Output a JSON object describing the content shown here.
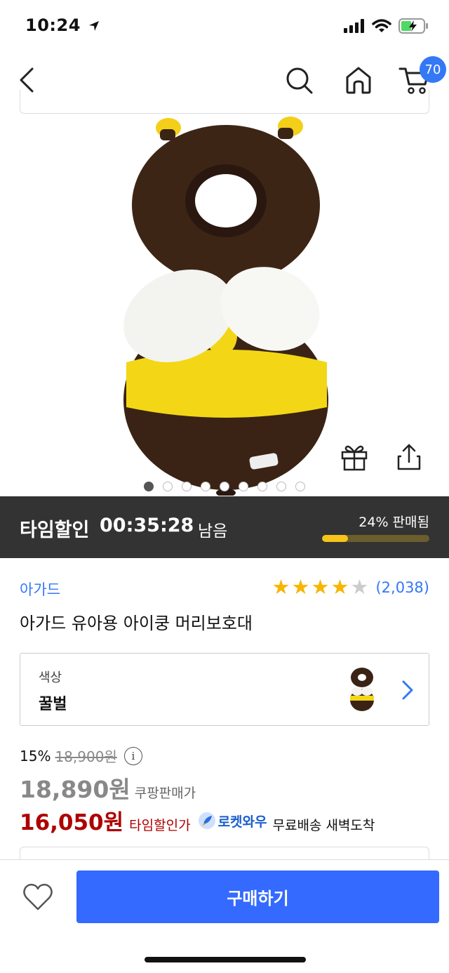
{
  "status": {
    "time": "10:24"
  },
  "nav": {
    "cart_count": "70"
  },
  "carousel": {
    "total": 9,
    "active_index": 4
  },
  "time_sale": {
    "label": "타임할인",
    "countdown": "00:35:28",
    "remaining_label": "남음",
    "sold_label": "24% 판매됨",
    "sold_fraction": 0.24
  },
  "product": {
    "brand": "아가드",
    "title": "아가드 유아용 아이쿵 머리보호대",
    "rating": 4,
    "rating_count": "(2,038)"
  },
  "option": {
    "label": "색상",
    "value": "꿀벌"
  },
  "price": {
    "discount": "15%",
    "original": "18,900원",
    "coupang_price": "18,890원",
    "coupang_label": "쿠팡판매가",
    "sale_price": "16,050원",
    "sale_label": "타임할인가",
    "rocket_label": "로켓와우",
    "shipping": "무료배송 새벽도착"
  },
  "bottom": {
    "buy_label": "구매하기"
  },
  "colors": {
    "accent": "#346aff",
    "link": "#3478f6",
    "sale_red": "#ae0000",
    "star": "#f7b500",
    "banner_bg": "#333333"
  }
}
